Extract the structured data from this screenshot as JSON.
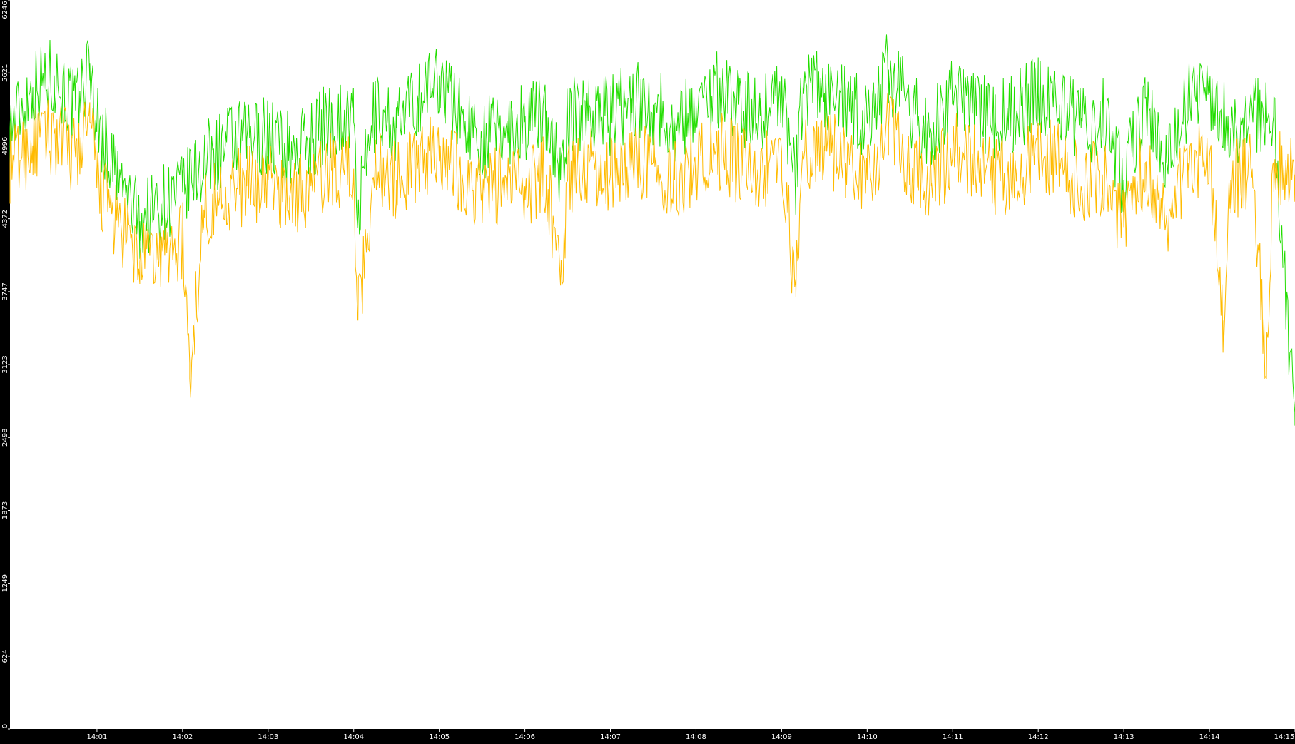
{
  "chart_data": {
    "type": "line",
    "title": "",
    "xlabel": "",
    "ylabel": "",
    "ylim": [
      0,
      6246
    ],
    "xlim": [
      "13:59:59",
      "14:15:00"
    ],
    "grid": false,
    "legend": "none",
    "y_ticks": [
      "0",
      "624",
      "1249",
      "1873",
      "2498",
      "3123",
      "3747",
      "4372",
      "4996",
      "5621",
      "6246"
    ],
    "x_ticks": [
      "14:01",
      "14:02",
      "14:03",
      "14:04",
      "14:05",
      "14:06",
      "14:07",
      "14:08",
      "14:09",
      "14:10",
      "14:11",
      "14:12",
      "14:13",
      "14:14",
      "14:15"
    ],
    "series": [
      {
        "color": "#22dd00",
        "x": [
          "13:59:59",
          "14:00:15",
          "14:00:30",
          "14:00:45",
          "14:00:55",
          "14:01:00",
          "14:01:15",
          "14:01:30",
          "14:01:45",
          "14:02:00",
          "14:02:15",
          "14:02:30",
          "14:02:45",
          "14:03:00",
          "14:03:15",
          "14:03:30",
          "14:03:45",
          "14:04:00",
          "14:04:03",
          "14:04:15",
          "14:04:30",
          "14:04:45",
          "14:05:00",
          "14:05:15",
          "14:05:30",
          "14:05:45",
          "14:06:00",
          "14:06:15",
          "14:06:25",
          "14:06:30",
          "14:06:45",
          "14:07:00",
          "14:07:15",
          "14:07:30",
          "14:07:45",
          "14:08:00",
          "14:08:15",
          "14:08:30",
          "14:08:45",
          "14:09:00",
          "14:09:10",
          "14:09:15",
          "14:09:30",
          "14:09:45",
          "14:10:00",
          "14:10:15",
          "14:10:30",
          "14:10:45",
          "14:11:00",
          "14:11:15",
          "14:11:30",
          "14:11:45",
          "14:12:00",
          "14:12:15",
          "14:12:30",
          "14:12:45",
          "14:13:00",
          "14:13:15",
          "14:13:30",
          "14:13:45",
          "14:14:00",
          "14:14:15",
          "14:14:30",
          "14:14:45",
          "14:15:00"
        ],
        "y": [
          5150,
          5500,
          5600,
          5300,
          5700,
          5200,
          4700,
          4350,
          4500,
          4600,
          4850,
          5000,
          5050,
          5100,
          4950,
          5050,
          5250,
          5200,
          4400,
          5300,
          5150,
          5400,
          5600,
          5250,
          5050,
          5150,
          5200,
          5300,
          4700,
          5200,
          5350,
          5250,
          5400,
          5350,
          5150,
          5350,
          5500,
          5350,
          5250,
          5500,
          4650,
          5500,
          5450,
          5350,
          5200,
          5650,
          5300,
          5100,
          5400,
          5350,
          5200,
          5300,
          5450,
          5350,
          5150,
          5250,
          4700,
          5400,
          4850,
          5400,
          5450,
          5150,
          5300,
          5250,
          2600
        ]
      },
      {
        "color": "#ffbb00",
        "x": [
          "13:59:59",
          "14:00:15",
          "14:00:30",
          "14:00:45",
          "14:00:55",
          "14:01:00",
          "14:01:15",
          "14:01:30",
          "14:01:45",
          "14:02:00",
          "14:02:05",
          "14:02:15",
          "14:02:30",
          "14:02:45",
          "14:03:00",
          "14:03:15",
          "14:03:30",
          "14:03:45",
          "14:04:00",
          "14:04:03",
          "14:04:15",
          "14:04:30",
          "14:04:45",
          "14:05:00",
          "14:05:15",
          "14:05:30",
          "14:05:45",
          "14:06:00",
          "14:06:15",
          "14:06:25",
          "14:06:30",
          "14:06:45",
          "14:07:00",
          "14:07:15",
          "14:07:30",
          "14:07:45",
          "14:08:00",
          "14:08:15",
          "14:08:30",
          "14:08:45",
          "14:09:00",
          "14:09:10",
          "14:09:15",
          "14:09:30",
          "14:09:45",
          "14:10:00",
          "14:10:15",
          "14:10:30",
          "14:10:45",
          "14:11:00",
          "14:11:15",
          "14:11:30",
          "14:11:45",
          "14:12:00",
          "14:12:15",
          "14:12:30",
          "14:12:45",
          "14:13:00",
          "14:13:15",
          "14:13:30",
          "14:13:45",
          "14:14:00",
          "14:14:10",
          "14:14:15",
          "14:14:30",
          "14:14:40",
          "14:14:45",
          "14:15:00"
        ],
        "y": [
          4850,
          5000,
          5100,
          4900,
          5200,
          4700,
          4300,
          4000,
          4050,
          4200,
          3000,
          4450,
          4600,
          4650,
          4700,
          4550,
          4650,
          4800,
          4800,
          3500,
          4850,
          4700,
          4850,
          5000,
          4750,
          4600,
          4700,
          4650,
          4750,
          3800,
          4700,
          4850,
          4750,
          4900,
          4850,
          4700,
          4850,
          4950,
          4850,
          4750,
          4950,
          3700,
          4900,
          5000,
          4850,
          4700,
          5150,
          4850,
          4650,
          4950,
          4900,
          4700,
          4800,
          4900,
          4850,
          4650,
          4750,
          4300,
          4850,
          4400,
          4850,
          4900,
          3500,
          4700,
          4800,
          3000,
          4850,
          4750
        ]
      }
    ]
  }
}
